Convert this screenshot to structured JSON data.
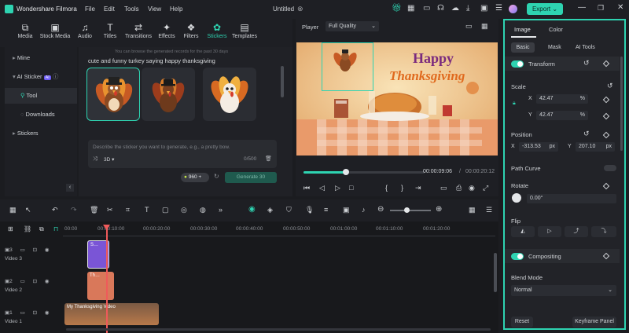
{
  "app": {
    "name": "Wondershare Filmora",
    "menu": [
      "File",
      "Edit",
      "Tools",
      "View",
      "Help"
    ],
    "project_title": "Untitled",
    "export_label": "Export"
  },
  "tools": [
    {
      "label": "Media",
      "icon": "media-icon"
    },
    {
      "label": "Stock Media",
      "icon": "stock-media-icon"
    },
    {
      "label": "Audio",
      "icon": "audio-icon"
    },
    {
      "label": "Titles",
      "icon": "titles-icon"
    },
    {
      "label": "Transitions",
      "icon": "transitions-icon"
    },
    {
      "label": "Effects",
      "icon": "effects-icon"
    },
    {
      "label": "Filters",
      "icon": "filters-icon"
    },
    {
      "label": "Stickers",
      "icon": "stickers-icon",
      "active": true
    },
    {
      "label": "Templates",
      "icon": "templates-icon"
    }
  ],
  "leftnav": {
    "mine": "Mine",
    "ai_sticker": "AI Sticker",
    "ai_badge": "AI",
    "tool": "Tool",
    "downloads": "Downloads",
    "stickers": "Stickers"
  },
  "stickers_panel": {
    "note": "You can browse the generated records for the past 30 days",
    "prompt_title": "cute and funny turkey saying happy thanksgiving",
    "input_placeholder": "Describe the sticker you want to generate, e.g., a pretty bow.",
    "style_label": "3D",
    "char_count": "0/500",
    "credits": "960",
    "generate_label": "Generate",
    "generate_cost": "30"
  },
  "player": {
    "label": "Player",
    "quality": "Full Quality",
    "current_time": "00:00:09:06",
    "total_time": "00:00:20:12",
    "progress": 0.35,
    "preview_text_1": "Happy",
    "preview_text_2": "Thanksgiving"
  },
  "props": {
    "tabs": [
      "Image",
      "Color"
    ],
    "subtabs": [
      "Basic",
      "Mask",
      "AI Tools"
    ],
    "transform": "Transform",
    "scale": "Scale",
    "scale_x_label": "X",
    "scale_x": "42.47",
    "scale_y_label": "Y",
    "scale_y": "42.47",
    "percent": "%",
    "position": "Position",
    "pos_x_label": "X",
    "pos_x": "-313.53",
    "pos_y_label": "Y",
    "pos_y": "207.10",
    "px": "px",
    "path_curve": "Path Curve",
    "rotate": "Rotate",
    "rotate_value": "0.00°",
    "flip": "Flip",
    "compositing": "Compositing",
    "blend_mode": "Blend Mode",
    "blend_value": "Normal",
    "reset": "Reset",
    "keyframe": "Keyframe Panel"
  },
  "timeline": {
    "ticks": [
      "00:00",
      "00:00:10:00",
      "00:00:20:00",
      "00:00:30:00",
      "00:00:40:00",
      "00:00:50:00",
      "00:01:00:00",
      "00:01:10:00",
      "00:01:20:00"
    ],
    "tracks": [
      {
        "num": "3",
        "name": "Video 3"
      },
      {
        "num": "2",
        "name": "Video 2"
      },
      {
        "num": "1",
        "name": "Video 1"
      }
    ],
    "clip_v3": "S…",
    "clip_v2": "Th…",
    "clip_v1": "My Thanksgiving Video"
  },
  "colors": {
    "accent": "#2ed3b1",
    "clip_purple": "#7a55d6",
    "clip_orange": "#d9785a"
  }
}
